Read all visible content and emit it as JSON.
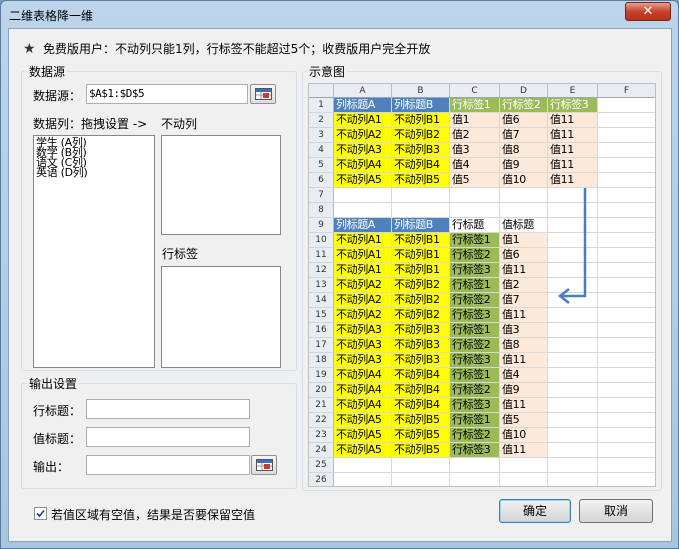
{
  "window": {
    "title": "二维表格降一维",
    "close_label": "✕"
  },
  "notice": "免费版用户：不动列只能1列，行标签不能超过5个；收费版用户完全开放",
  "datasource": {
    "group_label": "数据源",
    "source_label": "数据源：",
    "source_value": "$A$1:$D$5",
    "columns_label": "数据列：拖拽设置 ->",
    "fixed_label": "不动列",
    "rowlabel_label": "行标签",
    "columns": [
      "学生 (A列)",
      "数学 (B列)",
      "语文 (C列)",
      "英语 (D列)"
    ]
  },
  "output": {
    "group_label": "输出设置",
    "row_title_label": "行标题：",
    "value_title_label": "值标题：",
    "output_label": "输出：",
    "row_title_value": "",
    "value_title_value": "",
    "output_value": ""
  },
  "preview": {
    "group_label": "示意图",
    "col_headers": [
      "A",
      "B",
      "C",
      "D",
      "E",
      "F"
    ],
    "rows": [
      [
        "1",
        "列标题A",
        "列标题B",
        "行标签1",
        "行标签2",
        "行标签3",
        ""
      ],
      [
        "2",
        "不动列A1",
        "不动列B1",
        "值1",
        "值6",
        "值11",
        ""
      ],
      [
        "3",
        "不动列A2",
        "不动列B2",
        "值2",
        "值7",
        "值11",
        ""
      ],
      [
        "4",
        "不动列A3",
        "不动列B3",
        "值3",
        "值8",
        "值11",
        ""
      ],
      [
        "5",
        "不动列A4",
        "不动列B4",
        "值4",
        "值9",
        "值11",
        ""
      ],
      [
        "6",
        "不动列A5",
        "不动列B5",
        "值5",
        "值10",
        "值11",
        ""
      ],
      [
        "7",
        "",
        "",
        "",
        "",
        "",
        ""
      ],
      [
        "8",
        "",
        "",
        "",
        "",
        "",
        ""
      ],
      [
        "9",
        "列标题A",
        "列标题B",
        "行标题",
        "值标题",
        "",
        ""
      ],
      [
        "10",
        "不动列A1",
        "不动列B1",
        "行标签1",
        "值1",
        "",
        ""
      ],
      [
        "11",
        "不动列A1",
        "不动列B1",
        "行标签2",
        "值6",
        "",
        ""
      ],
      [
        "12",
        "不动列A1",
        "不动列B1",
        "行标签3",
        "值11",
        "",
        ""
      ],
      [
        "13",
        "不动列A2",
        "不动列B2",
        "行标签1",
        "值2",
        "",
        ""
      ],
      [
        "14",
        "不动列A2",
        "不动列B2",
        "行标签2",
        "值7",
        "",
        ""
      ],
      [
        "15",
        "不动列A2",
        "不动列B2",
        "行标签3",
        "值11",
        "",
        ""
      ],
      [
        "16",
        "不动列A3",
        "不动列B3",
        "行标签1",
        "值3",
        "",
        ""
      ],
      [
        "17",
        "不动列A3",
        "不动列B3",
        "行标签2",
        "值8",
        "",
        ""
      ],
      [
        "18",
        "不动列A3",
        "不动列B3",
        "行标签3",
        "值11",
        "",
        ""
      ],
      [
        "19",
        "不动列A4",
        "不动列B4",
        "行标签1",
        "值4",
        "",
        ""
      ],
      [
        "20",
        "不动列A4",
        "不动列B4",
        "行标签2",
        "值9",
        "",
        ""
      ],
      [
        "21",
        "不动列A4",
        "不动列B4",
        "行标签3",
        "值11",
        "",
        ""
      ],
      [
        "22",
        "不动列A5",
        "不动列B5",
        "行标签1",
        "值5",
        "",
        ""
      ],
      [
        "23",
        "不动列A5",
        "不动列B5",
        "行标签2",
        "值10",
        "",
        ""
      ],
      [
        "24",
        "不动列A5",
        "不动列B5",
        "行标签3",
        "值11",
        "",
        ""
      ],
      [
        "25",
        "",
        "",
        "",
        "",
        "",
        ""
      ],
      [
        "26",
        "",
        "",
        "",
        "",
        "",
        ""
      ]
    ],
    "colors": {
      "header_blue": "#4f81bd",
      "yellow": "#ffff00",
      "green": "#9bbb59",
      "peach": "#fde9d9",
      "arrow": "#4a7ebb"
    }
  },
  "footer": {
    "keep_empty_label": "若值区域有空值，结果是否要保留空值",
    "keep_empty_checked": true,
    "ok_label": "确定",
    "cancel_label": "取消"
  }
}
